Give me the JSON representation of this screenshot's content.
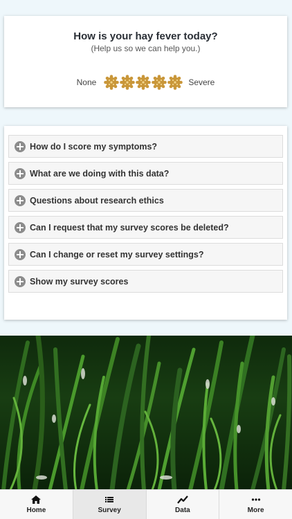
{
  "survey": {
    "question": "How is your hay fever today?",
    "subtitle": "(Help us so we can help you.)",
    "scale_min_label": "None",
    "scale_max_label": "Severe",
    "rating_count": 5,
    "flower_color": "#c9973a"
  },
  "faq": {
    "items": [
      {
        "label": "How do I score my symptoms?"
      },
      {
        "label": "What are we doing with this data?"
      },
      {
        "label": "Questions about research ethics"
      },
      {
        "label": "Can I request that my survey scores be deleted?"
      },
      {
        "label": "Can I change or reset my survey settings?"
      },
      {
        "label": "Show my survey scores"
      }
    ]
  },
  "tabbar": {
    "tabs": [
      {
        "label": "Home",
        "icon": "home-icon"
      },
      {
        "label": "Survey",
        "icon": "list-icon",
        "active": true
      },
      {
        "label": "Data",
        "icon": "chart-line-icon"
      },
      {
        "label": "More",
        "icon": "more-dots-icon"
      }
    ]
  }
}
